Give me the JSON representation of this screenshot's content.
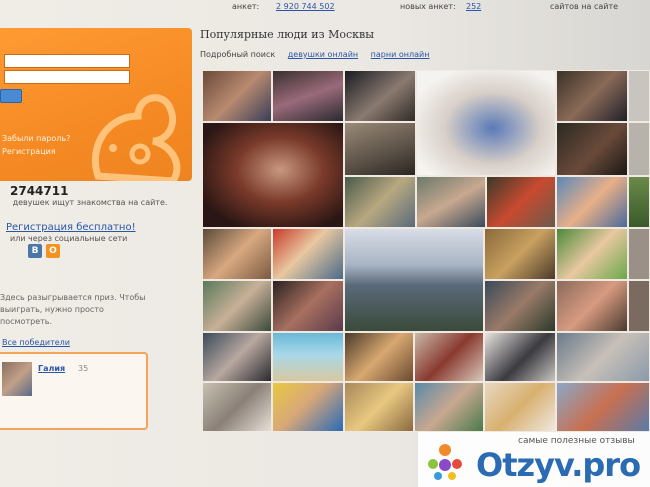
{
  "topbar": {
    "label_left": "анкет:",
    "count_left": "2 920 744 502",
    "label_mid": "новых анкет:",
    "count_mid": "252",
    "label_right": "сайтов на сайте"
  },
  "login": {
    "forgot": "Забыли пароль?",
    "register": "Регистрация"
  },
  "stats": {
    "count": "2744711",
    "desc": "девушек ищут знакомства на сайте."
  },
  "sidebar": {
    "register_link": "Регистрация бесплатно!",
    "via_social": "или через социальные сети"
  },
  "promo": {
    "text": "Здесь разыгрывается приз. Чтобы выиграть, нужно просто посмотреть.",
    "link": "Все победители"
  },
  "user_card": {
    "name": "Галия",
    "age": "35"
  },
  "popular": {
    "title": "Популярные люди из Москвы",
    "tabs": [
      "Подробный поиск",
      "девушки онлайн",
      "парни онлайн"
    ]
  },
  "watermark": {
    "tagline": "самые полезные отзывы",
    "brand": "Otzyv.pro"
  },
  "colors": {
    "panel_orange": "#f58a24",
    "link_blue": "#2a56a8",
    "brand_blue": "#2a6bb3",
    "vk_blue": "#4a76a8",
    "ok_orange": "#f39220"
  }
}
